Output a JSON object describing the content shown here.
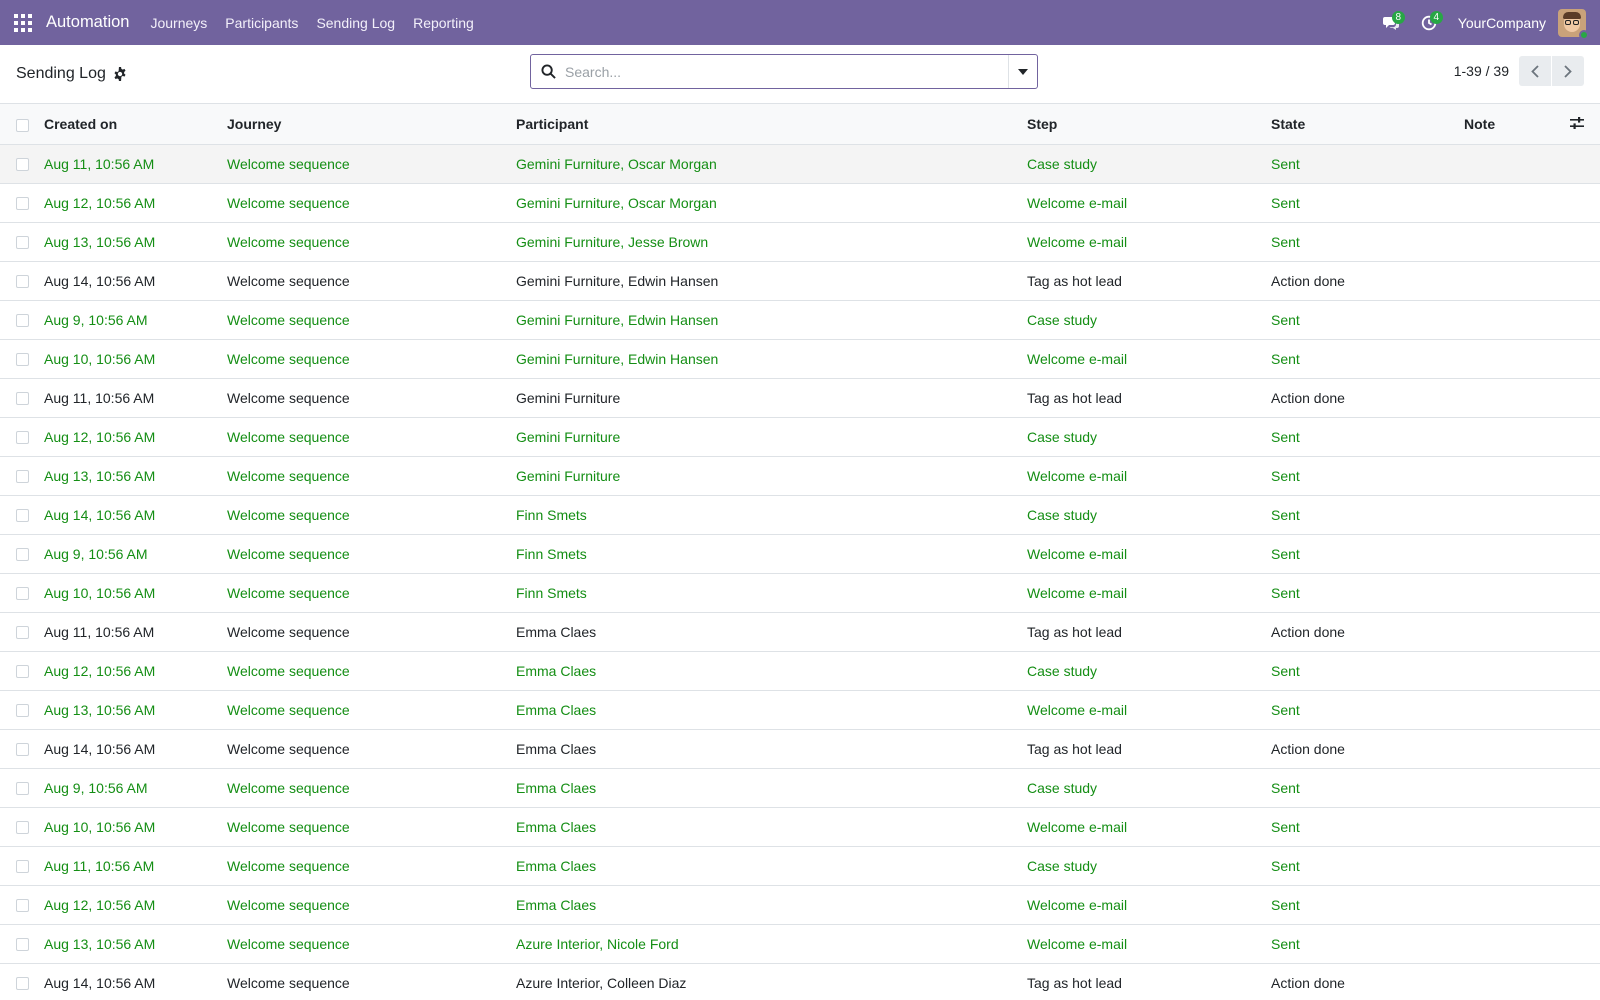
{
  "navbar": {
    "app_name": "Automation",
    "menu": [
      "Journeys",
      "Participants",
      "Sending Log",
      "Reporting"
    ],
    "messages_count": "8",
    "activities_count": "4",
    "company": "YourCompany",
    "bg_color": "#71639e"
  },
  "control_panel": {
    "title": "Sending Log",
    "search_placeholder": "Search...",
    "pager": "1-39 / 39"
  },
  "table": {
    "columns": [
      "Created on",
      "Journey",
      "Participant",
      "Step",
      "State",
      "Note"
    ],
    "status_colors": {
      "sent": "#148e14",
      "action_done": "#212529"
    },
    "rows": [
      {
        "created": "Aug 11, 10:56 AM",
        "journey": "Welcome sequence",
        "participant": "Gemini Furniture, Oscar Morgan",
        "step": "Case study",
        "state": "Sent",
        "note": ""
      },
      {
        "created": "Aug 12, 10:56 AM",
        "journey": "Welcome sequence",
        "participant": "Gemini Furniture, Oscar Morgan",
        "step": "Welcome e-mail",
        "state": "Sent",
        "note": ""
      },
      {
        "created": "Aug 13, 10:56 AM",
        "journey": "Welcome sequence",
        "participant": "Gemini Furniture, Jesse Brown",
        "step": "Welcome e-mail",
        "state": "Sent",
        "note": ""
      },
      {
        "created": "Aug 14, 10:56 AM",
        "journey": "Welcome sequence",
        "participant": "Gemini Furniture, Edwin Hansen",
        "step": "Tag as hot lead",
        "state": "Action done",
        "note": ""
      },
      {
        "created": "Aug 9, 10:56 AM",
        "journey": "Welcome sequence",
        "participant": "Gemini Furniture, Edwin Hansen",
        "step": "Case study",
        "state": "Sent",
        "note": ""
      },
      {
        "created": "Aug 10, 10:56 AM",
        "journey": "Welcome sequence",
        "participant": "Gemini Furniture, Edwin Hansen",
        "step": "Welcome e-mail",
        "state": "Sent",
        "note": ""
      },
      {
        "created": "Aug 11, 10:56 AM",
        "journey": "Welcome sequence",
        "participant": "Gemini Furniture",
        "step": "Tag as hot lead",
        "state": "Action done",
        "note": ""
      },
      {
        "created": "Aug 12, 10:56 AM",
        "journey": "Welcome sequence",
        "participant": "Gemini Furniture",
        "step": "Case study",
        "state": "Sent",
        "note": ""
      },
      {
        "created": "Aug 13, 10:56 AM",
        "journey": "Welcome sequence",
        "participant": "Gemini Furniture",
        "step": "Welcome e-mail",
        "state": "Sent",
        "note": ""
      },
      {
        "created": "Aug 14, 10:56 AM",
        "journey": "Welcome sequence",
        "participant": "Finn Smets",
        "step": "Case study",
        "state": "Sent",
        "note": ""
      },
      {
        "created": "Aug 9, 10:56 AM",
        "journey": "Welcome sequence",
        "participant": "Finn Smets",
        "step": "Welcome e-mail",
        "state": "Sent",
        "note": ""
      },
      {
        "created": "Aug 10, 10:56 AM",
        "journey": "Welcome sequence",
        "participant": "Finn Smets",
        "step": "Welcome e-mail",
        "state": "Sent",
        "note": ""
      },
      {
        "created": "Aug 11, 10:56 AM",
        "journey": "Welcome sequence",
        "participant": "Emma Claes",
        "step": "Tag as hot lead",
        "state": "Action done",
        "note": ""
      },
      {
        "created": "Aug 12, 10:56 AM",
        "journey": "Welcome sequence",
        "participant": "Emma Claes",
        "step": "Case study",
        "state": "Sent",
        "note": ""
      },
      {
        "created": "Aug 13, 10:56 AM",
        "journey": "Welcome sequence",
        "participant": "Emma Claes",
        "step": "Welcome e-mail",
        "state": "Sent",
        "note": ""
      },
      {
        "created": "Aug 14, 10:56 AM",
        "journey": "Welcome sequence",
        "participant": "Emma Claes",
        "step": "Tag as hot lead",
        "state": "Action done",
        "note": ""
      },
      {
        "created": "Aug 9, 10:56 AM",
        "journey": "Welcome sequence",
        "participant": "Emma Claes",
        "step": "Case study",
        "state": "Sent",
        "note": ""
      },
      {
        "created": "Aug 10, 10:56 AM",
        "journey": "Welcome sequence",
        "participant": "Emma Claes",
        "step": "Welcome e-mail",
        "state": "Sent",
        "note": ""
      },
      {
        "created": "Aug 11, 10:56 AM",
        "journey": "Welcome sequence",
        "participant": "Emma Claes",
        "step": "Case study",
        "state": "Sent",
        "note": ""
      },
      {
        "created": "Aug 12, 10:56 AM",
        "journey": "Welcome sequence",
        "participant": "Emma Claes",
        "step": "Welcome e-mail",
        "state": "Sent",
        "note": ""
      },
      {
        "created": "Aug 13, 10:56 AM",
        "journey": "Welcome sequence",
        "participant": "Azure Interior, Nicole Ford",
        "step": "Welcome e-mail",
        "state": "Sent",
        "note": ""
      },
      {
        "created": "Aug 14, 10:56 AM",
        "journey": "Welcome sequence",
        "participant": "Azure Interior, Colleen Diaz",
        "step": "Tag as hot lead",
        "state": "Action done",
        "note": ""
      }
    ]
  }
}
